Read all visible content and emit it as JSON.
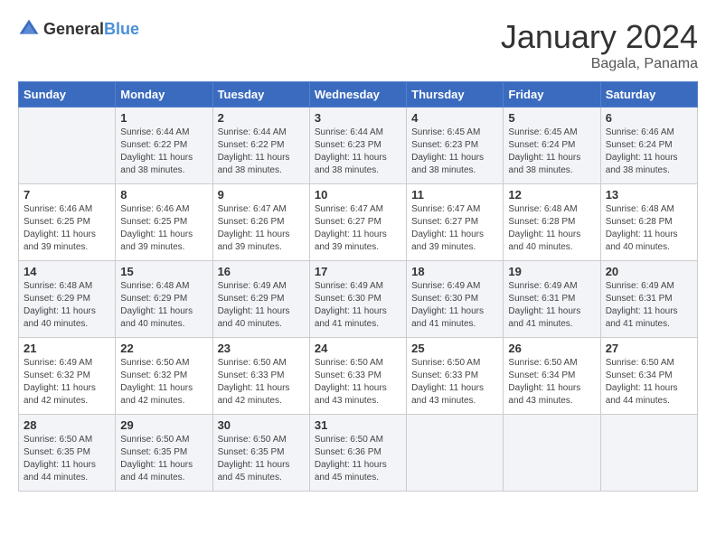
{
  "logo": {
    "general": "General",
    "blue": "Blue"
  },
  "title": "January 2024",
  "location": "Bagala, Panama",
  "days_header": [
    "Sunday",
    "Monday",
    "Tuesday",
    "Wednesday",
    "Thursday",
    "Friday",
    "Saturday"
  ],
  "weeks": [
    [
      {
        "day": "",
        "info": ""
      },
      {
        "day": "1",
        "info": "Sunrise: 6:44 AM\nSunset: 6:22 PM\nDaylight: 11 hours\nand 38 minutes."
      },
      {
        "day": "2",
        "info": "Sunrise: 6:44 AM\nSunset: 6:22 PM\nDaylight: 11 hours\nand 38 minutes."
      },
      {
        "day": "3",
        "info": "Sunrise: 6:44 AM\nSunset: 6:23 PM\nDaylight: 11 hours\nand 38 minutes."
      },
      {
        "day": "4",
        "info": "Sunrise: 6:45 AM\nSunset: 6:23 PM\nDaylight: 11 hours\nand 38 minutes."
      },
      {
        "day": "5",
        "info": "Sunrise: 6:45 AM\nSunset: 6:24 PM\nDaylight: 11 hours\nand 38 minutes."
      },
      {
        "day": "6",
        "info": "Sunrise: 6:46 AM\nSunset: 6:24 PM\nDaylight: 11 hours\nand 38 minutes."
      }
    ],
    [
      {
        "day": "7",
        "info": "Sunrise: 6:46 AM\nSunset: 6:25 PM\nDaylight: 11 hours\nand 39 minutes."
      },
      {
        "day": "8",
        "info": "Sunrise: 6:46 AM\nSunset: 6:25 PM\nDaylight: 11 hours\nand 39 minutes."
      },
      {
        "day": "9",
        "info": "Sunrise: 6:47 AM\nSunset: 6:26 PM\nDaylight: 11 hours\nand 39 minutes."
      },
      {
        "day": "10",
        "info": "Sunrise: 6:47 AM\nSunset: 6:27 PM\nDaylight: 11 hours\nand 39 minutes."
      },
      {
        "day": "11",
        "info": "Sunrise: 6:47 AM\nSunset: 6:27 PM\nDaylight: 11 hours\nand 39 minutes."
      },
      {
        "day": "12",
        "info": "Sunrise: 6:48 AM\nSunset: 6:28 PM\nDaylight: 11 hours\nand 40 minutes."
      },
      {
        "day": "13",
        "info": "Sunrise: 6:48 AM\nSunset: 6:28 PM\nDaylight: 11 hours\nand 40 minutes."
      }
    ],
    [
      {
        "day": "14",
        "info": "Sunrise: 6:48 AM\nSunset: 6:29 PM\nDaylight: 11 hours\nand 40 minutes."
      },
      {
        "day": "15",
        "info": "Sunrise: 6:48 AM\nSunset: 6:29 PM\nDaylight: 11 hours\nand 40 minutes."
      },
      {
        "day": "16",
        "info": "Sunrise: 6:49 AM\nSunset: 6:29 PM\nDaylight: 11 hours\nand 40 minutes."
      },
      {
        "day": "17",
        "info": "Sunrise: 6:49 AM\nSunset: 6:30 PM\nDaylight: 11 hours\nand 41 minutes."
      },
      {
        "day": "18",
        "info": "Sunrise: 6:49 AM\nSunset: 6:30 PM\nDaylight: 11 hours\nand 41 minutes."
      },
      {
        "day": "19",
        "info": "Sunrise: 6:49 AM\nSunset: 6:31 PM\nDaylight: 11 hours\nand 41 minutes."
      },
      {
        "day": "20",
        "info": "Sunrise: 6:49 AM\nSunset: 6:31 PM\nDaylight: 11 hours\nand 41 minutes."
      }
    ],
    [
      {
        "day": "21",
        "info": "Sunrise: 6:49 AM\nSunset: 6:32 PM\nDaylight: 11 hours\nand 42 minutes."
      },
      {
        "day": "22",
        "info": "Sunrise: 6:50 AM\nSunset: 6:32 PM\nDaylight: 11 hours\nand 42 minutes."
      },
      {
        "day": "23",
        "info": "Sunrise: 6:50 AM\nSunset: 6:33 PM\nDaylight: 11 hours\nand 42 minutes."
      },
      {
        "day": "24",
        "info": "Sunrise: 6:50 AM\nSunset: 6:33 PM\nDaylight: 11 hours\nand 43 minutes."
      },
      {
        "day": "25",
        "info": "Sunrise: 6:50 AM\nSunset: 6:33 PM\nDaylight: 11 hours\nand 43 minutes."
      },
      {
        "day": "26",
        "info": "Sunrise: 6:50 AM\nSunset: 6:34 PM\nDaylight: 11 hours\nand 43 minutes."
      },
      {
        "day": "27",
        "info": "Sunrise: 6:50 AM\nSunset: 6:34 PM\nDaylight: 11 hours\nand 44 minutes."
      }
    ],
    [
      {
        "day": "28",
        "info": "Sunrise: 6:50 AM\nSunset: 6:35 PM\nDaylight: 11 hours\nand 44 minutes."
      },
      {
        "day": "29",
        "info": "Sunrise: 6:50 AM\nSunset: 6:35 PM\nDaylight: 11 hours\nand 44 minutes."
      },
      {
        "day": "30",
        "info": "Sunrise: 6:50 AM\nSunset: 6:35 PM\nDaylight: 11 hours\nand 45 minutes."
      },
      {
        "day": "31",
        "info": "Sunrise: 6:50 AM\nSunset: 6:36 PM\nDaylight: 11 hours\nand 45 minutes."
      },
      {
        "day": "",
        "info": ""
      },
      {
        "day": "",
        "info": ""
      },
      {
        "day": "",
        "info": ""
      }
    ]
  ]
}
